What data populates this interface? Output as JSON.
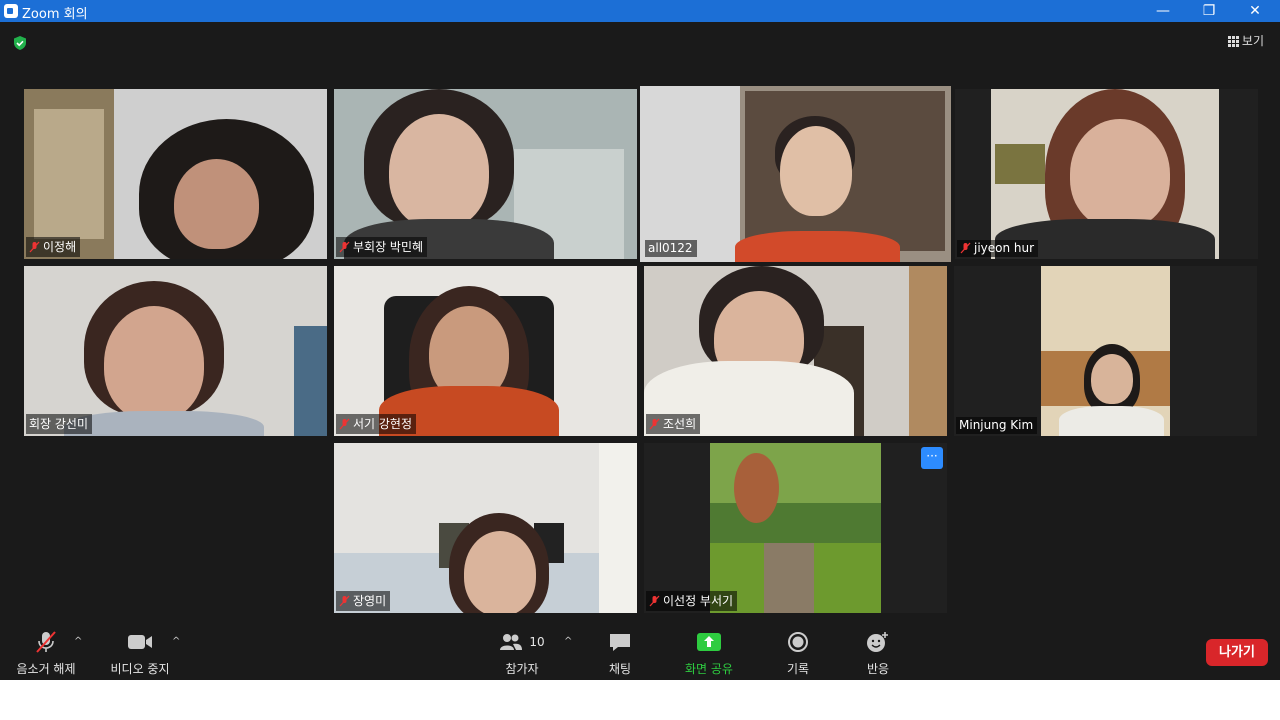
{
  "window": {
    "title": "Zoom 회의",
    "minimize": "—",
    "restore": "❐",
    "close": "✕"
  },
  "view_button": {
    "label": "보기"
  },
  "participants": [
    {
      "name": "이정해",
      "muted": true
    },
    {
      "name": "부회장 박민혜",
      "muted": true
    },
    {
      "name": "all0122",
      "muted": false,
      "active_speaker": true
    },
    {
      "name": "jiyeon hur",
      "muted": true
    },
    {
      "name": "회장 강선미",
      "muted": false
    },
    {
      "name": "서기 강현정",
      "muted": true
    },
    {
      "name": "조선희",
      "muted": true
    },
    {
      "name": "Minjung Kim",
      "muted": false
    },
    {
      "name": "장영미",
      "muted": true
    },
    {
      "name": "이선정 부서기",
      "muted": true
    }
  ],
  "more_button": {
    "label": "···"
  },
  "toolbar": {
    "unmute": "음소거 해제",
    "stop_video": "비디오 중지",
    "participants": "참가자",
    "participants_count": "10",
    "chat": "채팅",
    "share_screen": "화면 공유",
    "record": "기록",
    "reactions": "반응",
    "leave": "나가기",
    "caret": "^"
  },
  "colors": {
    "titlebar": "#1c6fd6",
    "active_border": "#d6e35e",
    "share_green": "#2ecc40",
    "leave_red": "#d9262a",
    "accent_blue": "#2d8cff"
  }
}
